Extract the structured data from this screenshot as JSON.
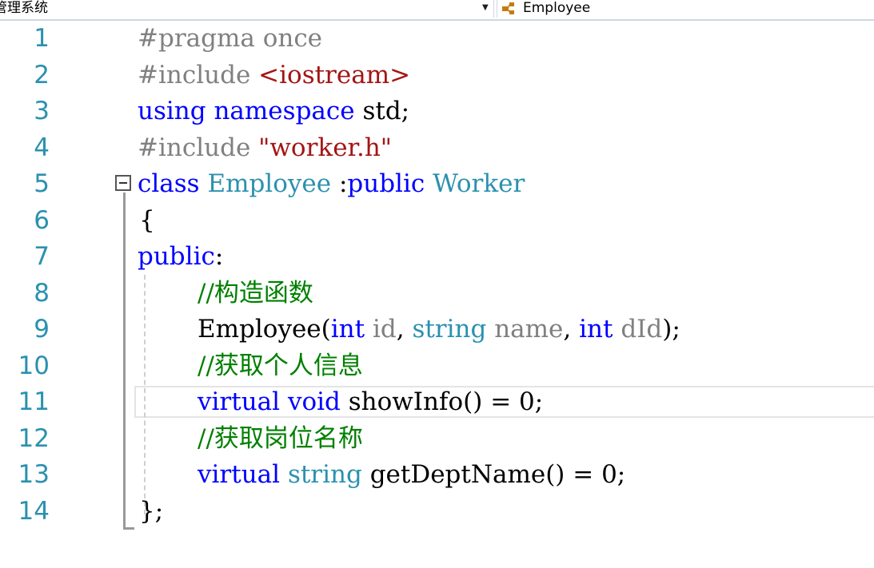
{
  "toolbar": {
    "project_scope": "管理系统",
    "class_scope": "Employee"
  },
  "colors": {
    "keyword": "#0000ff",
    "type": "#2b91af",
    "preprocessor": "#808080",
    "string": "#a31515",
    "comment": "#008000",
    "line_number": "#2b91af"
  },
  "line_numbers": [
    "1",
    "2",
    "3",
    "4",
    "5",
    "6",
    "7",
    "8",
    "9",
    "10",
    "11",
    "12",
    "13",
    "14"
  ],
  "code": {
    "l1": {
      "directive": "#pragma once"
    },
    "l2": {
      "directive": "#include ",
      "header": "<iostream>"
    },
    "l3": {
      "using": "using",
      "namespace": "namespace",
      "rest": " std;"
    },
    "l4": {
      "directive": "#include ",
      "header": "\"worker.h\""
    },
    "l5": {
      "kw_class": "class",
      "name": "Employee",
      "colon": " :",
      "kw_public": "public",
      "base": "Worker"
    },
    "l6": {
      "brace": "{"
    },
    "l7": {
      "kw_public": "public",
      "colon": ":"
    },
    "l8": {
      "comment": "//构造函数"
    },
    "l9": {
      "ctor": "Employee(",
      "t1": "int",
      "p1": " id",
      "sep1": ", ",
      "t2": "string",
      "p2": " name",
      "sep2": ", ",
      "t3": "int",
      "p3": " dId",
      "end": ");"
    },
    "l10": {
      "comment": "//获取个人信息"
    },
    "l11": {
      "kw_virtual": "virtual",
      "kw_void": "void",
      "rest": " showInfo() = 0;"
    },
    "l12": {
      "comment": "//获取岗位名称"
    },
    "l13": {
      "kw_virtual": "virtual",
      "ty_string": "string",
      "rest": " getDeptName() = 0;"
    },
    "l14": {
      "close": "};"
    }
  }
}
